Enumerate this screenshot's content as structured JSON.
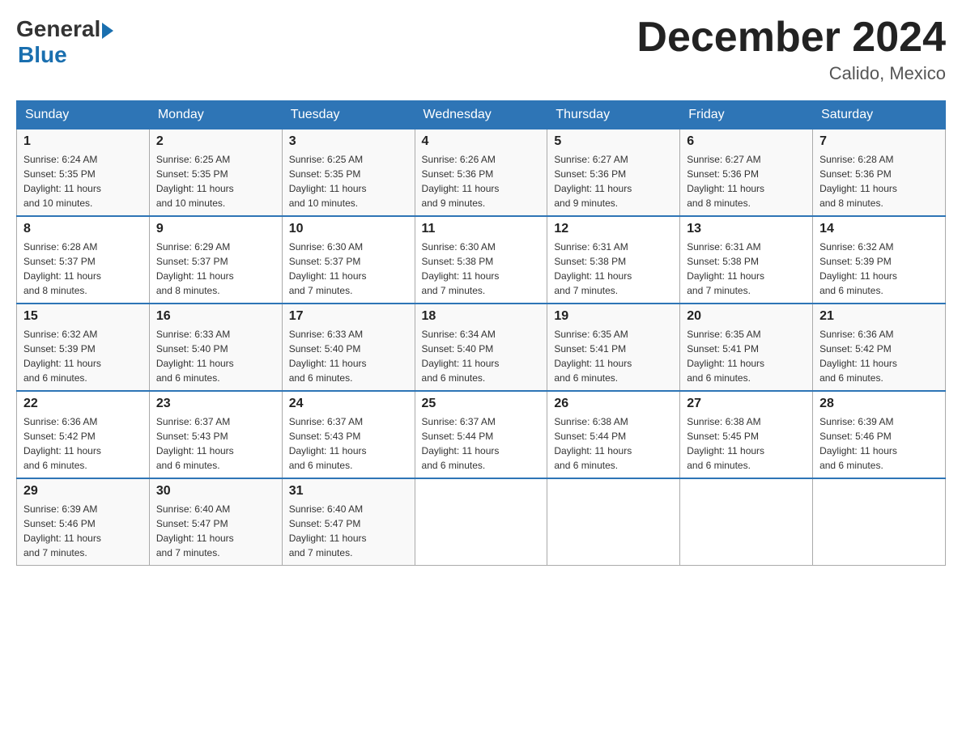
{
  "logo": {
    "text_general": "General",
    "text_blue": "Blue",
    "arrow": "▶"
  },
  "title": "December 2024",
  "location": "Calido, Mexico",
  "days_of_week": [
    "Sunday",
    "Monday",
    "Tuesday",
    "Wednesday",
    "Thursday",
    "Friday",
    "Saturday"
  ],
  "weeks": [
    [
      {
        "day": "1",
        "sunrise": "6:24 AM",
        "sunset": "5:35 PM",
        "daylight": "11 hours and 10 minutes."
      },
      {
        "day": "2",
        "sunrise": "6:25 AM",
        "sunset": "5:35 PM",
        "daylight": "11 hours and 10 minutes."
      },
      {
        "day": "3",
        "sunrise": "6:25 AM",
        "sunset": "5:35 PM",
        "daylight": "11 hours and 10 minutes."
      },
      {
        "day": "4",
        "sunrise": "6:26 AM",
        "sunset": "5:36 PM",
        "daylight": "11 hours and 9 minutes."
      },
      {
        "day": "5",
        "sunrise": "6:27 AM",
        "sunset": "5:36 PM",
        "daylight": "11 hours and 9 minutes."
      },
      {
        "day": "6",
        "sunrise": "6:27 AM",
        "sunset": "5:36 PM",
        "daylight": "11 hours and 8 minutes."
      },
      {
        "day": "7",
        "sunrise": "6:28 AM",
        "sunset": "5:36 PM",
        "daylight": "11 hours and 8 minutes."
      }
    ],
    [
      {
        "day": "8",
        "sunrise": "6:28 AM",
        "sunset": "5:37 PM",
        "daylight": "11 hours and 8 minutes."
      },
      {
        "day": "9",
        "sunrise": "6:29 AM",
        "sunset": "5:37 PM",
        "daylight": "11 hours and 8 minutes."
      },
      {
        "day": "10",
        "sunrise": "6:30 AM",
        "sunset": "5:37 PM",
        "daylight": "11 hours and 7 minutes."
      },
      {
        "day": "11",
        "sunrise": "6:30 AM",
        "sunset": "5:38 PM",
        "daylight": "11 hours and 7 minutes."
      },
      {
        "day": "12",
        "sunrise": "6:31 AM",
        "sunset": "5:38 PM",
        "daylight": "11 hours and 7 minutes."
      },
      {
        "day": "13",
        "sunrise": "6:31 AM",
        "sunset": "5:38 PM",
        "daylight": "11 hours and 7 minutes."
      },
      {
        "day": "14",
        "sunrise": "6:32 AM",
        "sunset": "5:39 PM",
        "daylight": "11 hours and 6 minutes."
      }
    ],
    [
      {
        "day": "15",
        "sunrise": "6:32 AM",
        "sunset": "5:39 PM",
        "daylight": "11 hours and 6 minutes."
      },
      {
        "day": "16",
        "sunrise": "6:33 AM",
        "sunset": "5:40 PM",
        "daylight": "11 hours and 6 minutes."
      },
      {
        "day": "17",
        "sunrise": "6:33 AM",
        "sunset": "5:40 PM",
        "daylight": "11 hours and 6 minutes."
      },
      {
        "day": "18",
        "sunrise": "6:34 AM",
        "sunset": "5:40 PM",
        "daylight": "11 hours and 6 minutes."
      },
      {
        "day": "19",
        "sunrise": "6:35 AM",
        "sunset": "5:41 PM",
        "daylight": "11 hours and 6 minutes."
      },
      {
        "day": "20",
        "sunrise": "6:35 AM",
        "sunset": "5:41 PM",
        "daylight": "11 hours and 6 minutes."
      },
      {
        "day": "21",
        "sunrise": "6:36 AM",
        "sunset": "5:42 PM",
        "daylight": "11 hours and 6 minutes."
      }
    ],
    [
      {
        "day": "22",
        "sunrise": "6:36 AM",
        "sunset": "5:42 PM",
        "daylight": "11 hours and 6 minutes."
      },
      {
        "day": "23",
        "sunrise": "6:37 AM",
        "sunset": "5:43 PM",
        "daylight": "11 hours and 6 minutes."
      },
      {
        "day": "24",
        "sunrise": "6:37 AM",
        "sunset": "5:43 PM",
        "daylight": "11 hours and 6 minutes."
      },
      {
        "day": "25",
        "sunrise": "6:37 AM",
        "sunset": "5:44 PM",
        "daylight": "11 hours and 6 minutes."
      },
      {
        "day": "26",
        "sunrise": "6:38 AM",
        "sunset": "5:44 PM",
        "daylight": "11 hours and 6 minutes."
      },
      {
        "day": "27",
        "sunrise": "6:38 AM",
        "sunset": "5:45 PM",
        "daylight": "11 hours and 6 minutes."
      },
      {
        "day": "28",
        "sunrise": "6:39 AM",
        "sunset": "5:46 PM",
        "daylight": "11 hours and 6 minutes."
      }
    ],
    [
      {
        "day": "29",
        "sunrise": "6:39 AM",
        "sunset": "5:46 PM",
        "daylight": "11 hours and 7 minutes."
      },
      {
        "day": "30",
        "sunrise": "6:40 AM",
        "sunset": "5:47 PM",
        "daylight": "11 hours and 7 minutes."
      },
      {
        "day": "31",
        "sunrise": "6:40 AM",
        "sunset": "5:47 PM",
        "daylight": "11 hours and 7 minutes."
      },
      null,
      null,
      null,
      null
    ]
  ],
  "labels": {
    "sunrise": "Sunrise:",
    "sunset": "Sunset:",
    "daylight": "Daylight:"
  }
}
